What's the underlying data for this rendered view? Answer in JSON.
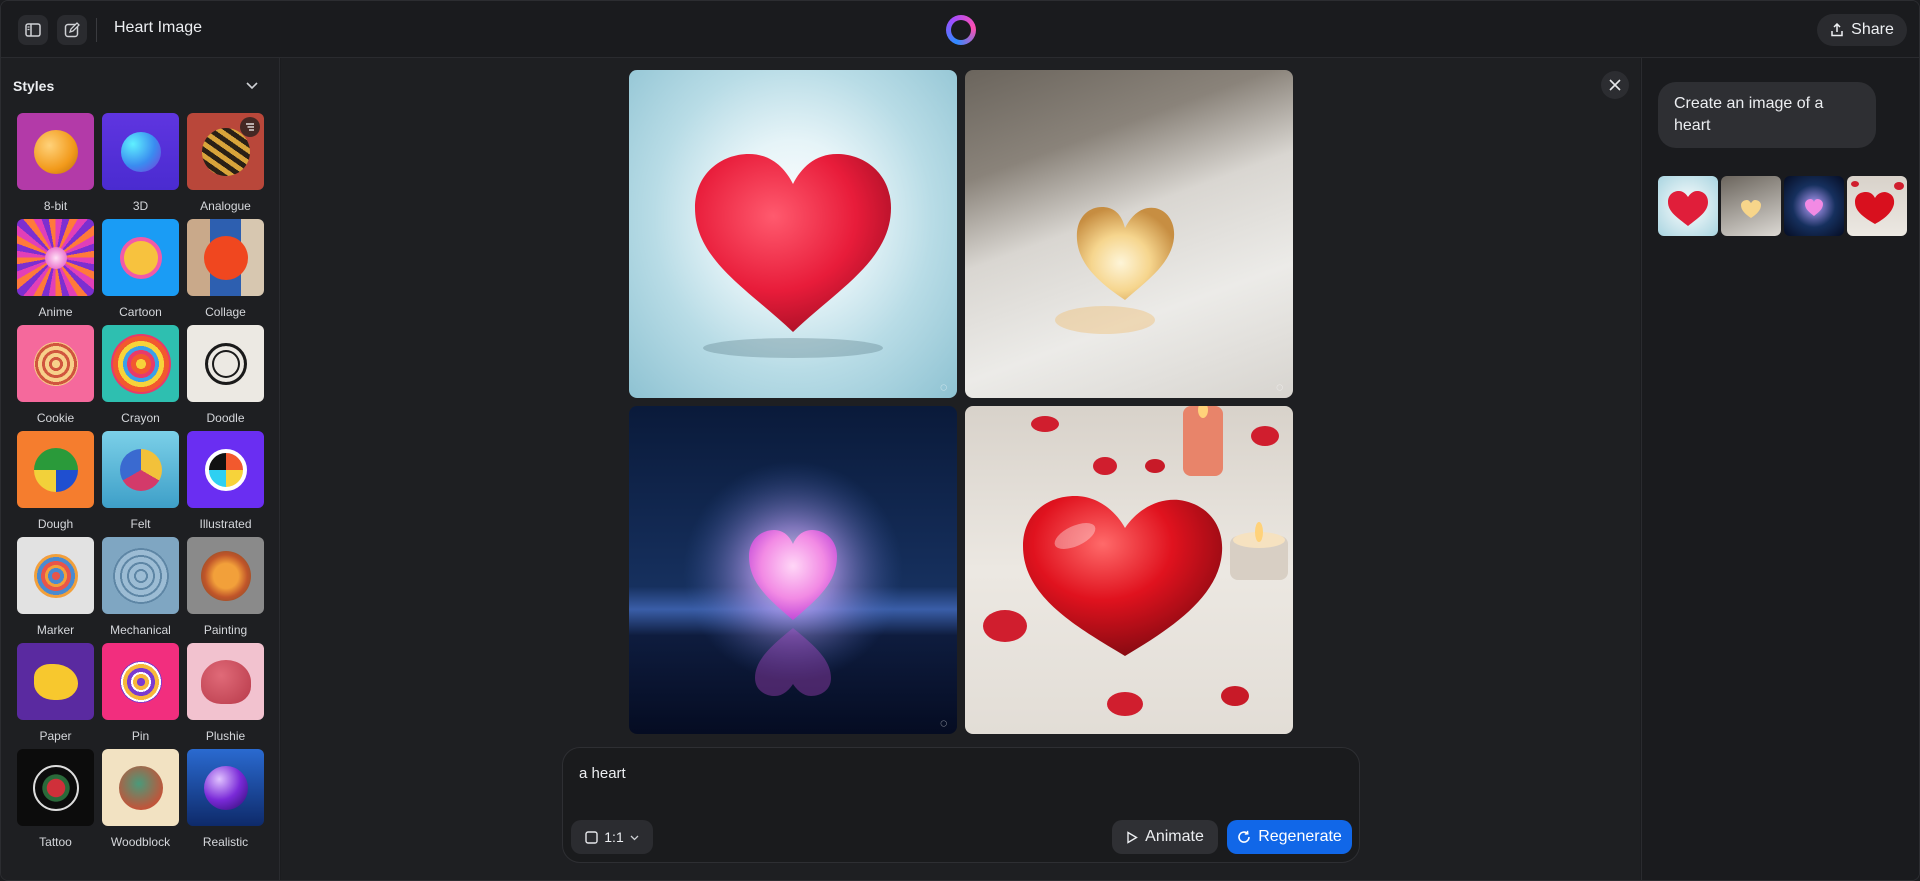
{
  "header": {
    "title": "Heart Image",
    "share_label": "Share",
    "icons": [
      "sidebar-toggle-icon",
      "new-chat-icon",
      "meta-ai-logo",
      "share-icon"
    ]
  },
  "sidebar": {
    "heading": "Styles",
    "styles": [
      {
        "label": "8-bit"
      },
      {
        "label": "3D"
      },
      {
        "label": "Analogue"
      },
      {
        "label": "Anime"
      },
      {
        "label": "Cartoon"
      },
      {
        "label": "Collage"
      },
      {
        "label": "Cookie"
      },
      {
        "label": "Crayon"
      },
      {
        "label": "Doodle"
      },
      {
        "label": "Dough"
      },
      {
        "label": "Felt"
      },
      {
        "label": "Illustrated"
      },
      {
        "label": "Marker"
      },
      {
        "label": "Mechanical"
      },
      {
        "label": "Painting"
      },
      {
        "label": "Paper"
      },
      {
        "label": "Pin"
      },
      {
        "label": "Plushie"
      },
      {
        "label": "Tattoo"
      },
      {
        "label": "Woodblock"
      },
      {
        "label": "Realistic"
      }
    ]
  },
  "prompt": {
    "text": "a heart",
    "ratio": "1:1",
    "animate_label": "Animate",
    "regenerate_label": "Regenerate"
  },
  "chat": {
    "user_message": "Create an image of a heart"
  },
  "colors": {
    "accent": "#1167e8",
    "background": "#1e1f22"
  }
}
